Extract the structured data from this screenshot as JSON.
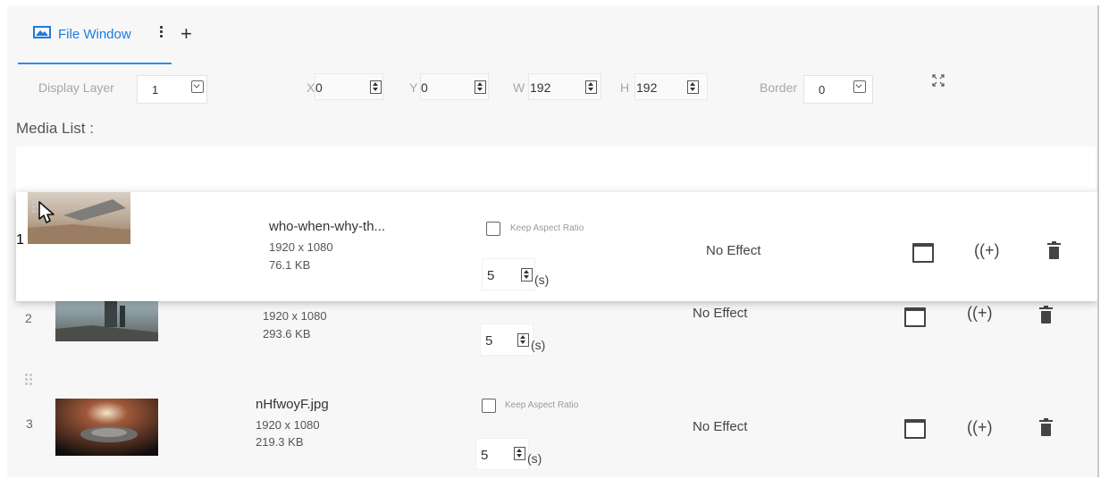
{
  "tabs": [
    {
      "label": "File Window",
      "icon": "image-icon",
      "active": true
    }
  ],
  "add_tab_symbol": "+",
  "toolbar": {
    "display_layer_label": "Display Layer",
    "display_layer_value": "1",
    "x_label": "X",
    "x_value": "0",
    "y_label": "Y",
    "y_value": "0",
    "w_label": "W",
    "w_value": "192",
    "h_label": "H",
    "h_value": "192",
    "border_label": "Border",
    "border_value": "0",
    "fullscreen_icon": "fit-screen-icon"
  },
  "media_list_title": "Media List :",
  "media": [
    {
      "index": "1",
      "name": "who-when-why-th...",
      "resolution": "1920 x 1080",
      "size": "76.1 KB",
      "keep_aspect_label": "Keep Aspect Ratio",
      "keep_aspect": false,
      "duration": "5",
      "duration_unit": "(s)",
      "effect": "No Effect",
      "dragging": true
    },
    {
      "index": "2",
      "name": "",
      "resolution": "1920 x 1080",
      "size": "293.6 KB",
      "duration": "5",
      "duration_unit": "(s)",
      "effect": "No Effect"
    },
    {
      "index": "3",
      "name": "nHfwoyF.jpg",
      "resolution": "1920 x 1080",
      "size": "219.3 KB",
      "keep_aspect_label": "Keep Aspect Ratio",
      "keep_aspect": false,
      "duration": "5",
      "duration_unit": "(s)",
      "effect": "No Effect"
    }
  ],
  "row_actions": {
    "schedule_icon": "calendar-icon",
    "add_icon": "add-circle-icon",
    "delete_icon": "trash-icon"
  },
  "colors": {
    "accent": "#2f8be8",
    "background": "#f7f7f7"
  }
}
